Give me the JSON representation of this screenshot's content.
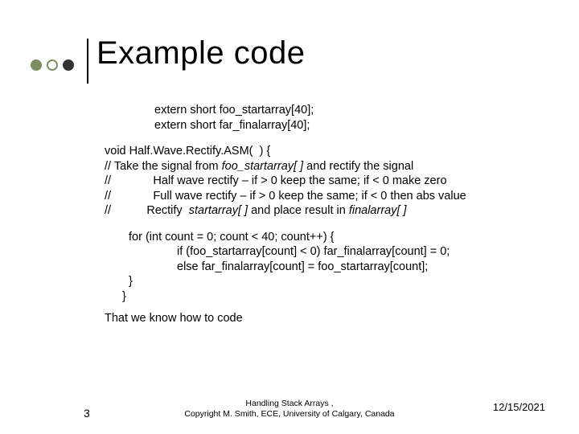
{
  "title": "Example code",
  "decl": {
    "l1": "extern short foo_startarray[40];",
    "l2": "extern short far_finalarray[40];"
  },
  "sig": "void Half.Wave.Rectify.ASM(  ) {",
  "cmt": {
    "c1a": "// Take the signal from ",
    "c1b": "foo_startarray[ ]",
    "c1c": " and rectify the signal",
    "c2": "//             Half wave rectify – if > 0 keep the same; if < 0 make zero",
    "c3": "//             Full wave rectify – if > 0 keep the same; if < 0 then abs value",
    "c4a": "//           Rectify  ",
    "c4b": "startarray[ ]",
    "c4c": " and place result in ",
    "c4d": "finalarray[ ]"
  },
  "loop": {
    "l1": "for (int count = 0; count < 40; count++) {",
    "l2": "if (foo_startarray[count] < 0) far_finalarray[count] = 0;",
    "l3": "else far_finalarray[count] = foo_startarray[count];",
    "l4": "}",
    "l5": "}"
  },
  "closing": "That we know how to code",
  "footer": {
    "num": "3",
    "center_l1": "Handling Stack Arrays                 ,",
    "center_l2": "Copyright M. Smith, ECE, University of Calgary, Canada",
    "date": "12/15/2021"
  }
}
